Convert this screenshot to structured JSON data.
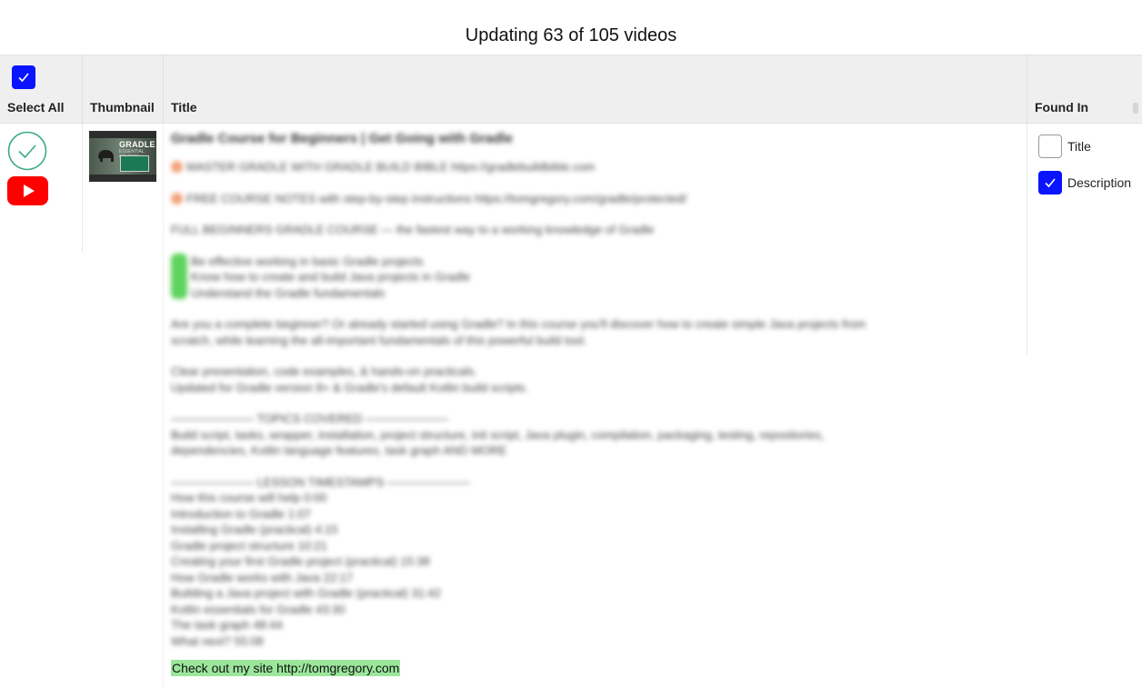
{
  "page": {
    "title": "Updating 63 of 105 videos"
  },
  "table": {
    "columns": {
      "select": "Select All",
      "thumbnail": "Thumbnail",
      "title": "Title",
      "found_in": "Found In"
    },
    "select_all_checked": true
  },
  "row": {
    "status": "check-circle-icon",
    "platform_icon": "youtube-icon",
    "thumbnail_text": "GRADLE",
    "thumbnail_subtext": "ESSENTIAL COURSE",
    "video_title": "Gradle Course for Beginners | Get Going with Gradle",
    "description": [
      [
        "MASTER GRADLE WITH GRADLE BUILD BIBLE https://gradlebuildbible.com"
      ],
      [
        "FREE COURSE NOTES with step-by-step instructions https://tomgregory.com/gradle/protected/"
      ],
      [
        "FULL BEGINNERS GRADLE COURSE — the fastest way to a working knowledge of Gradle"
      ],
      [
        "Be effective working in basic Gradle projects",
        "Know how to create and build Java projects in Gradle",
        "Understand the Gradle fundamentals"
      ],
      [
        "Are you a complete beginner? Or already started using Gradle? In this course you'll discover how to create simple Java projects from",
        "scratch, while learning the all-important fundamentals of this powerful build tool."
      ],
      [
        "Clear presentation, code examples, & hands-on practicals.",
        "Updated for Gradle version 8+ & Gradle's default Kotlin build scripts."
      ],
      [
        "——————— TOPICS COVERED ———————",
        "Build script, tasks, wrapper, installation, project structure, init script, Java plugin, compilation, packaging, testing, repositories,",
        "dependencies, Kotlin language features, task graph AND MORE"
      ],
      [
        "——————— LESSON TIMESTAMPS ———————",
        "How this course will help 0:00",
        "Introduction to Gradle 1:07",
        "Installing Gradle (practical) 4:15",
        "Gradle project structure 10:21",
        "Creating your first Gradle project (practical) 15:38",
        "How Gradle works with Java 22:17",
        "Building a Java project with Gradle (practical) 31:42",
        "Kotlin essentials for Gradle 43:30",
        "The task graph 48:44",
        "What next? 55:08"
      ]
    ],
    "highlighted_text": "Check out my site http://tomgregory.com",
    "found_in": [
      {
        "label": "Title",
        "checked": false
      },
      {
        "label": "Description",
        "checked": true
      }
    ]
  },
  "colors": {
    "checkbox_checked": "#0a14ff",
    "status_green": "#3aaa85",
    "youtube_red": "#ff0000",
    "highlight_green": "#9ce69c",
    "header_bg": "#efefef"
  }
}
